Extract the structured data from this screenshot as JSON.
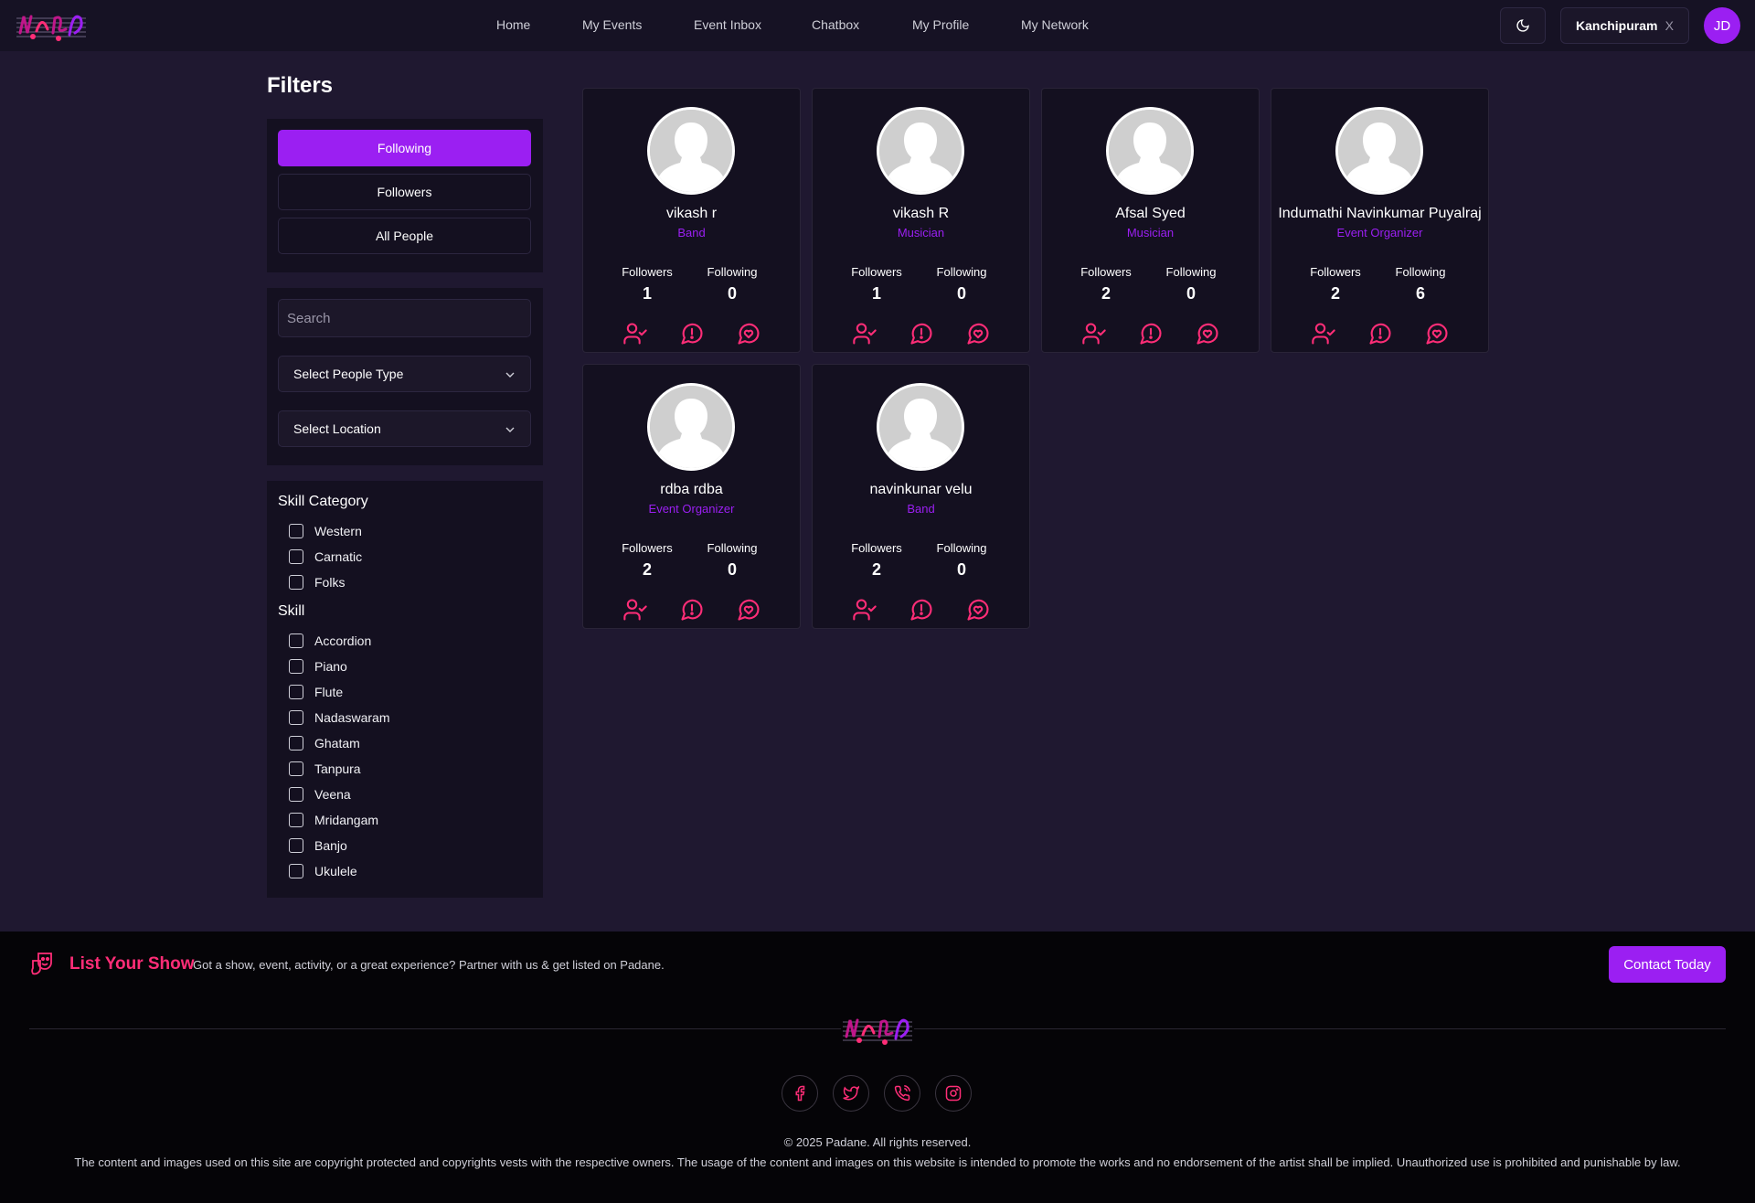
{
  "header": {
    "nav": [
      "Home",
      "My Events",
      "Event Inbox",
      "Chatbox",
      "My Profile",
      "My Network"
    ],
    "location": "Kanchipuram",
    "location_clear": "X",
    "avatar_initials": "JD"
  },
  "sidebar": {
    "title": "Filters",
    "tabs": [
      "Following",
      "Followers",
      "All People"
    ],
    "active_tab": "Following",
    "search_placeholder": "Search",
    "people_type_label": "Select People Type",
    "location_label": "Select Location",
    "skill_category_title": "Skill Category",
    "skill_categories": [
      "Western",
      "Carnatic",
      "Folks"
    ],
    "skill_title": "Skill",
    "skills": [
      "Accordion",
      "Piano",
      "Flute",
      "Nadaswaram",
      "Ghatam",
      "Tanpura",
      "Veena",
      "Mridangam",
      "Banjo",
      "Ukulele"
    ]
  },
  "people": [
    {
      "name": "vikash r",
      "role": "Band",
      "followers_label": "Followers",
      "followers": "1",
      "following_label": "Following",
      "following": "0"
    },
    {
      "name": "vikash R",
      "role": "Musician",
      "followers_label": "Followers",
      "followers": "1",
      "following_label": "Following",
      "following": "0"
    },
    {
      "name": "Afsal Syed",
      "role": "Musician",
      "followers_label": "Followers",
      "followers": "2",
      "following_label": "Following",
      "following": "0"
    },
    {
      "name": "Indumathi Navinkumar Puyalraj",
      "role": "Event Organizer",
      "followers_label": "Followers",
      "followers": "2",
      "following_label": "Following",
      "following": "6"
    },
    {
      "name": "rdba rdba",
      "role": "Event Organizer",
      "followers_label": "Followers",
      "followers": "2",
      "following_label": "Following",
      "following": "0"
    },
    {
      "name": "navinkunar velu",
      "role": "Band",
      "followers_label": "Followers",
      "followers": "2",
      "following_label": "Following",
      "following": "0"
    }
  ],
  "footer": {
    "list_title": "List Your Show",
    "list_text": "Got a show, event, activity, or a great experience? Partner with us & get listed on Padane.",
    "contact_label": "Contact Today",
    "copyright": "© 2025 Padane. All rights reserved.",
    "disclaimer": "The content and images used on this site are copyright protected and copyrights vests with the respective owners. The usage of the content and images on this website is intended to promote the works and no endorsement of the artist shall be implied. Unauthorized use is prohibited and punishable by law."
  },
  "colors": {
    "accent": "#9b1ff2",
    "icon_pink": "#ff2d77",
    "page_bg": "#1f1830",
    "panel_bg": "#141020",
    "footer_bg": "#050407"
  },
  "icons": {
    "header": [
      "logo",
      "moon-icon",
      "close-icon"
    ],
    "card_actions": [
      "user-check-icon",
      "report-icon",
      "chat-heart-icon"
    ],
    "footer": [
      "list-show-icon",
      "facebook-icon",
      "twitter-icon",
      "phone-icon",
      "instagram-icon"
    ]
  }
}
